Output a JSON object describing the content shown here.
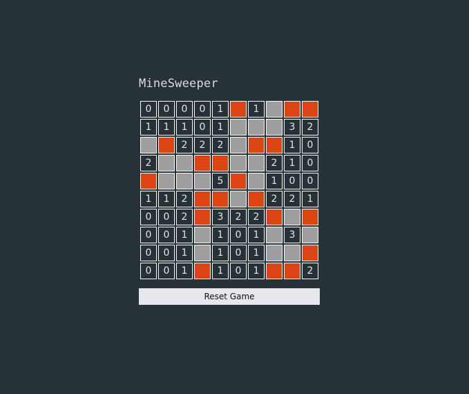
{
  "title": "MineSweeper",
  "reset_label": "Reset Game",
  "colors": {
    "background": "#263238",
    "hidden_cell": "#9e9e9e",
    "flagged_cell": "#dd4414",
    "cell_border": "#ffffff",
    "button": "#e8e8ec"
  },
  "legend": {
    "number": "revealed cell showing adjacent mine count",
    "H": "unrevealed cell",
    "F": "flagged cell"
  },
  "board": [
    [
      "0",
      "0",
      "0",
      "0",
      "1",
      "F",
      "1",
      "H",
      "F",
      "F"
    ],
    [
      "1",
      "1",
      "1",
      "0",
      "1",
      "H",
      "H",
      "H",
      "3",
      "2"
    ],
    [
      "H",
      "F",
      "2",
      "2",
      "2",
      "H",
      "F",
      "F",
      "1",
      "0"
    ],
    [
      "2",
      "H",
      "H",
      "F",
      "F",
      "H",
      "H",
      "2",
      "1",
      "0"
    ],
    [
      "F",
      "H",
      "H",
      "H",
      "5",
      "F",
      "H",
      "1",
      "0",
      "0"
    ],
    [
      "1",
      "1",
      "2",
      "F",
      "F",
      "H",
      "F",
      "2",
      "2",
      "1"
    ],
    [
      "0",
      "0",
      "2",
      "F",
      "3",
      "2",
      "2",
      "F",
      "H",
      "F"
    ],
    [
      "0",
      "0",
      "1",
      "H",
      "1",
      "0",
      "1",
      "H",
      "3",
      "H"
    ],
    [
      "0",
      "0",
      "1",
      "H",
      "1",
      "0",
      "1",
      "H",
      "H",
      "F"
    ],
    [
      "0",
      "0",
      "1",
      "F",
      "1",
      "0",
      "1",
      "F",
      "F",
      "2"
    ]
  ]
}
